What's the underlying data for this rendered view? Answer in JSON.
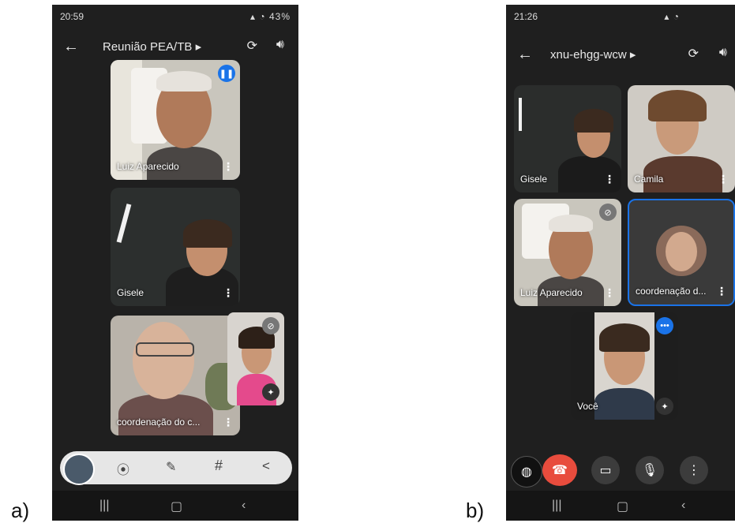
{
  "panel_a": {
    "figure_label": "a)",
    "status_time": "20:59",
    "status_right": "43%",
    "meeting_title": "Reunião PEA/TB",
    "tiles": [
      {
        "name": "Luiz Aparecido"
      },
      {
        "name": "Gisele"
      },
      {
        "name": "coordenação do c..."
      }
    ],
    "toolbar_icons": [
      "screenshot-icon",
      "edit-icon",
      "hash-icon",
      "share-icon"
    ],
    "toolbar_glyphs": [
      "⦿",
      "✎",
      "#",
      "<"
    ]
  },
  "panel_b": {
    "figure_label": "b)",
    "status_time": "21:26",
    "meeting_title": "xnu-ehgg-wcw",
    "tiles": [
      {
        "name": "Gisele"
      },
      {
        "name": "Camila"
      },
      {
        "name": "Luiz Aparecido"
      },
      {
        "name": "coordenação d..."
      },
      {
        "name": "Você"
      }
    ]
  },
  "colors": {
    "background": "#1f1f1f",
    "end_call": "#e84c3d",
    "speaking_border": "#1a73e8"
  }
}
